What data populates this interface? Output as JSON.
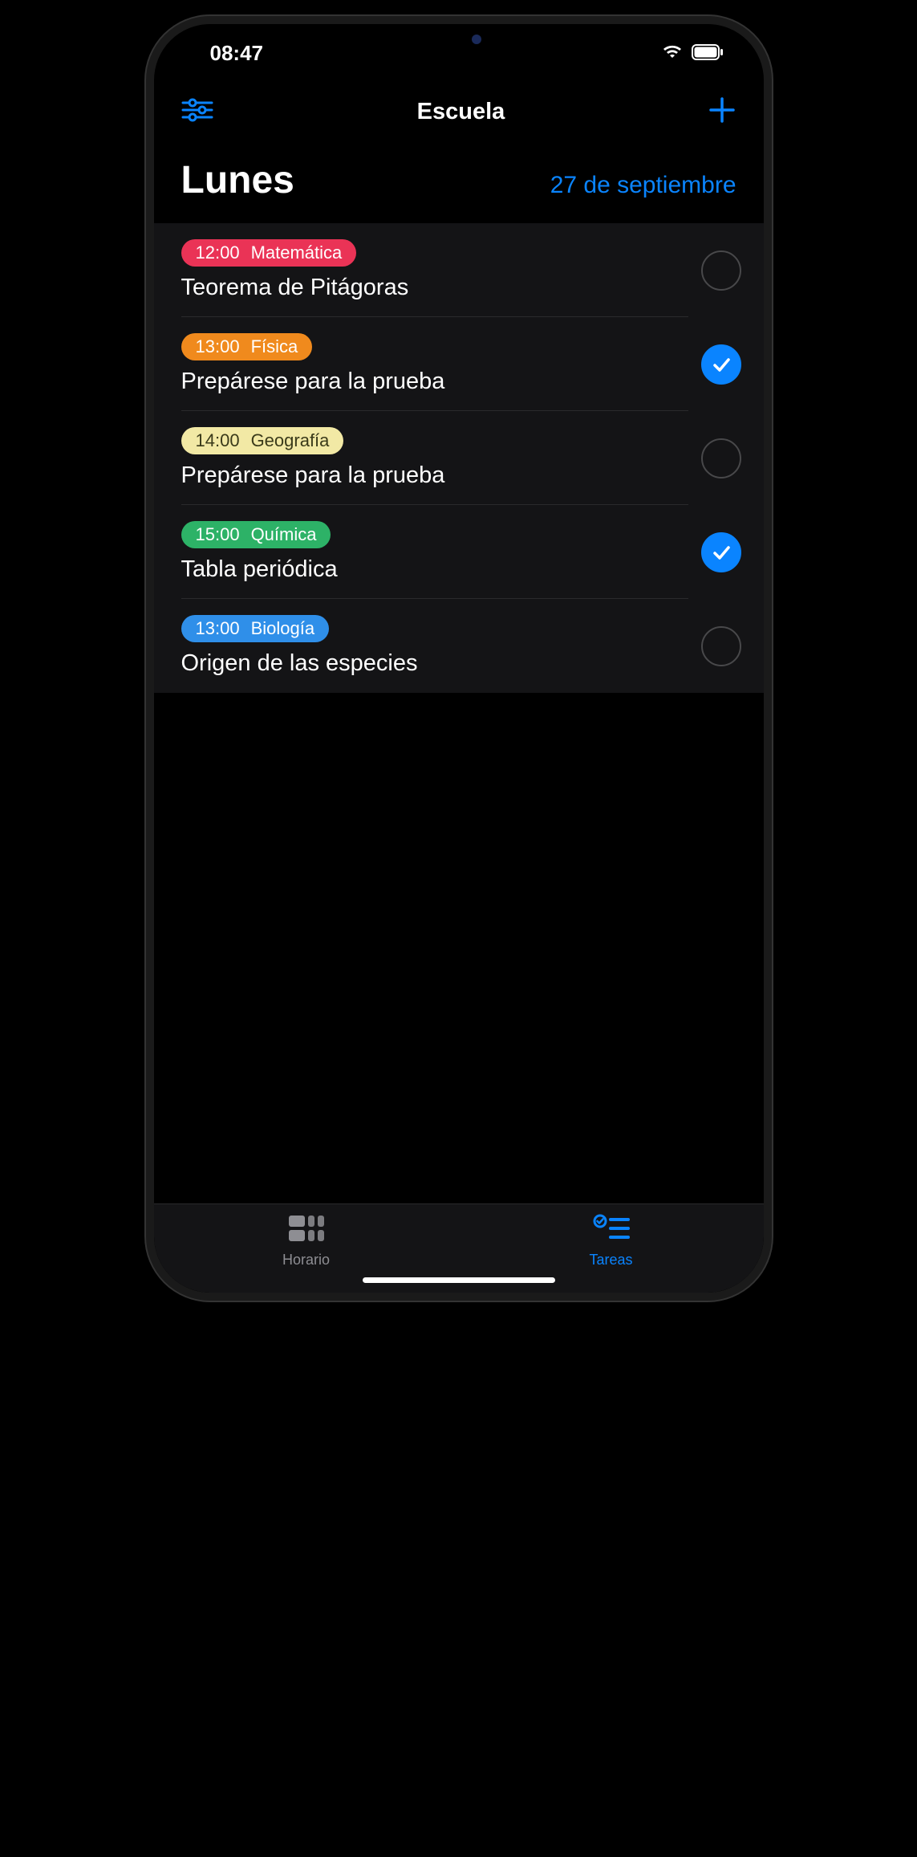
{
  "status": {
    "time": "08:47"
  },
  "nav": {
    "title": "Escuela"
  },
  "header": {
    "day": "Lunes",
    "date": "27 de septiembre"
  },
  "tasks": [
    {
      "time": "12:00",
      "subject": "Matemática",
      "title": "Teorema de Pitágoras",
      "color": "#ea3356",
      "textcolor": "#ffffff",
      "done": false
    },
    {
      "time": "13:00",
      "subject": "Física",
      "title": "Prepárese para la prueba",
      "color": "#f08a1d",
      "textcolor": "#ffffff",
      "done": true
    },
    {
      "time": "14:00",
      "subject": "Geografía",
      "title": "Prepárese para la prueba",
      "color": "#f2e9a5",
      "textcolor": "#3a3a1a",
      "done": false
    },
    {
      "time": "15:00",
      "subject": "Química",
      "title": "Tabla periódica",
      "color": "#2db267",
      "textcolor": "#ffffff",
      "done": true
    },
    {
      "time": "13:00",
      "subject": "Biología",
      "title": "Origen de las especies",
      "color": "#2f8fe9",
      "textcolor": "#ffffff",
      "done": false
    }
  ],
  "tabs": [
    {
      "id": "horario",
      "label": "Horario",
      "active": false
    },
    {
      "id": "tareas",
      "label": "Tareas",
      "active": true
    }
  ]
}
